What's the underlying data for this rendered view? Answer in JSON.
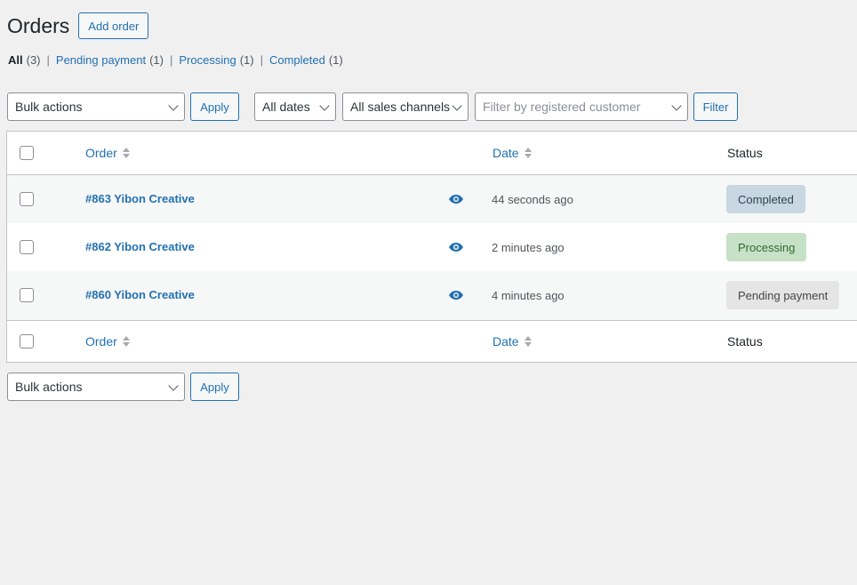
{
  "page": {
    "title": "Orders",
    "add_label": "Add order"
  },
  "views": [
    {
      "label": "All",
      "count": "(3)"
    },
    {
      "label": "Pending payment",
      "count": "(1)"
    },
    {
      "label": "Processing",
      "count": "(1)"
    },
    {
      "label": "Completed",
      "count": "(1)"
    }
  ],
  "filters": {
    "bulk_actions": "Bulk actions",
    "apply_label": "Apply",
    "dates": "All dates",
    "channels": "All sales channels",
    "customer_placeholder": "Filter by registered customer",
    "filter_label": "Filter"
  },
  "table": {
    "columns": {
      "order": "Order",
      "date": "Date",
      "status": "Status"
    },
    "rows": [
      {
        "order": "#863 Yibon Creative",
        "date": "44 seconds ago",
        "status": "Completed"
      },
      {
        "order": "#862 Yibon Creative",
        "date": "2 minutes ago",
        "status": "Processing"
      },
      {
        "order": "#860 Yibon Creative",
        "date": "4 minutes ago",
        "status": "Pending payment"
      }
    ]
  },
  "bottom": {
    "bulk_actions": "Bulk actions",
    "apply_label": "Apply"
  },
  "colors": {
    "link": "#2271b1",
    "completed_bg": "#c8d7e1",
    "processing_bg": "#c6e1c6",
    "pending_bg": "#e5e5e5"
  }
}
